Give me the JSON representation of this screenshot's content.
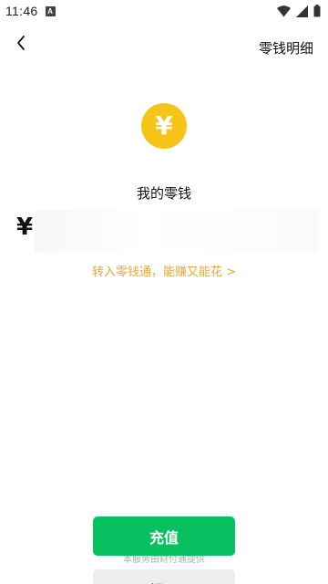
{
  "status_bar": {
    "time": "11:46",
    "notification_badge": "A",
    "icons": [
      "wifi-icon",
      "signal-icon",
      "battery-icon"
    ]
  },
  "header": {
    "back_icon": "chevron-left-icon",
    "detail_link": "零钱明细"
  },
  "wallet": {
    "icon": "yen-coin-icon",
    "coin_symbol": "¥",
    "title": "我的零钱",
    "currency_symbol": "¥",
    "balance_masked": true,
    "transfer_link": "转入零钱通，能赚又能花 >"
  },
  "actions": {
    "recharge_label": "充值",
    "withdraw_label": "提现",
    "provider_note": "本服务由财付通提供"
  },
  "colors": {
    "accent_green": "#07c160",
    "coin_yellow": "#f6c416",
    "link_orange": "#e7a53b"
  }
}
